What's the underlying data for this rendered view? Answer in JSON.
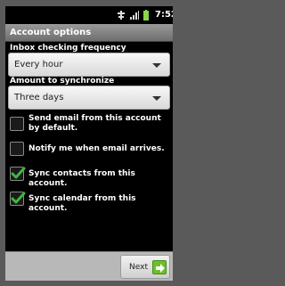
{
  "status_bar": {
    "time": "7:52",
    "icons": [
      "usb-icon",
      "signal-icon",
      "battery-icon"
    ]
  },
  "title": "Account options",
  "inbox_frequency": {
    "label": "Inbox checking frequency",
    "value": "Every hour"
  },
  "sync_amount": {
    "label": "Amount to synchronize",
    "value": "Three days"
  },
  "options": [
    {
      "label": "Send email from this account by default.",
      "checked": false
    },
    {
      "label": "Notify me when email arrives.",
      "checked": false
    },
    {
      "label": "Sync contacts from this account.",
      "checked": true
    },
    {
      "label": "Sync calendar from this account.",
      "checked": true
    }
  ],
  "footer": {
    "next_label": "Next"
  },
  "colors": {
    "check": "#3fb63f",
    "next_icon": "#6cc02a",
    "title_bar": "#808080"
  }
}
